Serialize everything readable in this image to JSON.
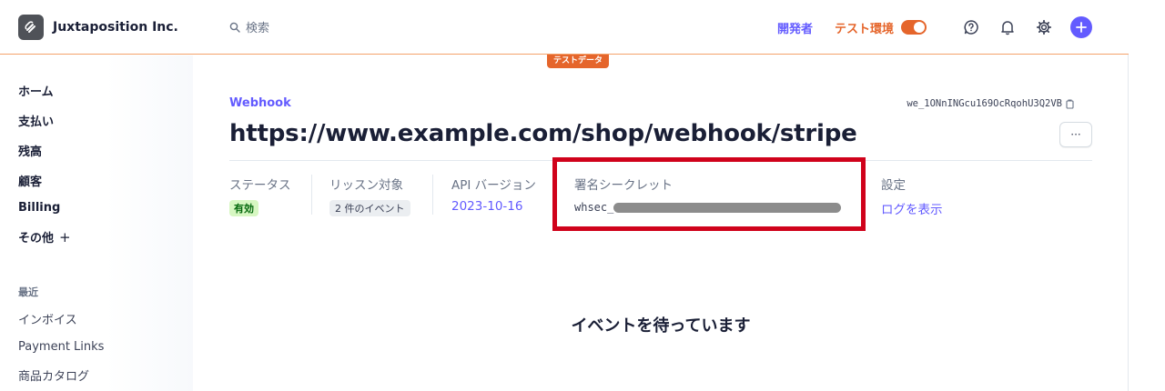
{
  "header": {
    "company": "Juxtaposition Inc.",
    "search_placeholder": "検索",
    "developers": "開発者",
    "test_mode": "テスト環境",
    "test_badge": "テストデータ"
  },
  "sidebar": {
    "items": [
      {
        "label": "ホーム"
      },
      {
        "label": "支払い"
      },
      {
        "label": "残高"
      },
      {
        "label": "顧客"
      },
      {
        "label": "Billing"
      },
      {
        "label": "その他"
      }
    ],
    "recent_title": "最近",
    "recent": [
      {
        "label": "インボイス"
      },
      {
        "label": "Payment Links"
      },
      {
        "label": "商品カタログ"
      }
    ]
  },
  "main": {
    "breadcrumb": "Webhook",
    "endpoint_id": "we_1ONnINGcu169OcRqohU3Q2VB",
    "title": "https://www.example.com/shop/webhook/stripe",
    "more_label": "···",
    "status_label": "ステータス",
    "status_value": "有効",
    "listen_label": "リッスン対象",
    "listen_value": "2 件のイベント",
    "api_label": "API バージョン",
    "api_value": "2023-10-16",
    "secret_label": "署名シークレット",
    "secret_value": "whsec_",
    "settings_label": "設定",
    "settings_link": "ログを表示",
    "empty_state": "イベントを待っています"
  },
  "colors": {
    "accent": "#635bff",
    "test_orange": "#e5652b",
    "highlight_red": "#d0021b",
    "status_green_bg": "#d7f7c2"
  }
}
